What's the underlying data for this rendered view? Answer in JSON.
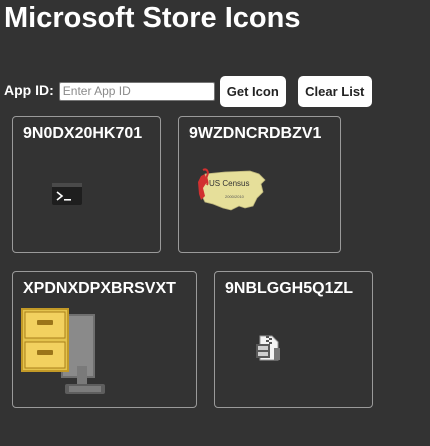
{
  "page": {
    "title": "Microsoft Store Icons"
  },
  "controls": {
    "app_id_label": "App ID:",
    "app_id_placeholder": "Enter App ID",
    "app_id_value": "",
    "get_icon_label": "Get Icon",
    "clear_list_label": "Clear List"
  },
  "cards": [
    {
      "app_id": "9N0DX20HK701",
      "icon": "terminal-icon"
    },
    {
      "app_id": "9WZDNCRDBZV1",
      "icon": "us-census-map-icon",
      "icon_text": "US Census",
      "icon_subtext": "2000/2010"
    },
    {
      "app_id": "XPDNXDPXBRSVXT",
      "icon": "winzip-cabinet-icon"
    },
    {
      "app_id": "9NBLGGH5Q1ZL",
      "icon": "archive-file-icon"
    }
  ],
  "colors": {
    "background": "#333333",
    "text": "#ffffff",
    "card_border": "#9a9a9a",
    "button_bg": "#ffffff"
  }
}
